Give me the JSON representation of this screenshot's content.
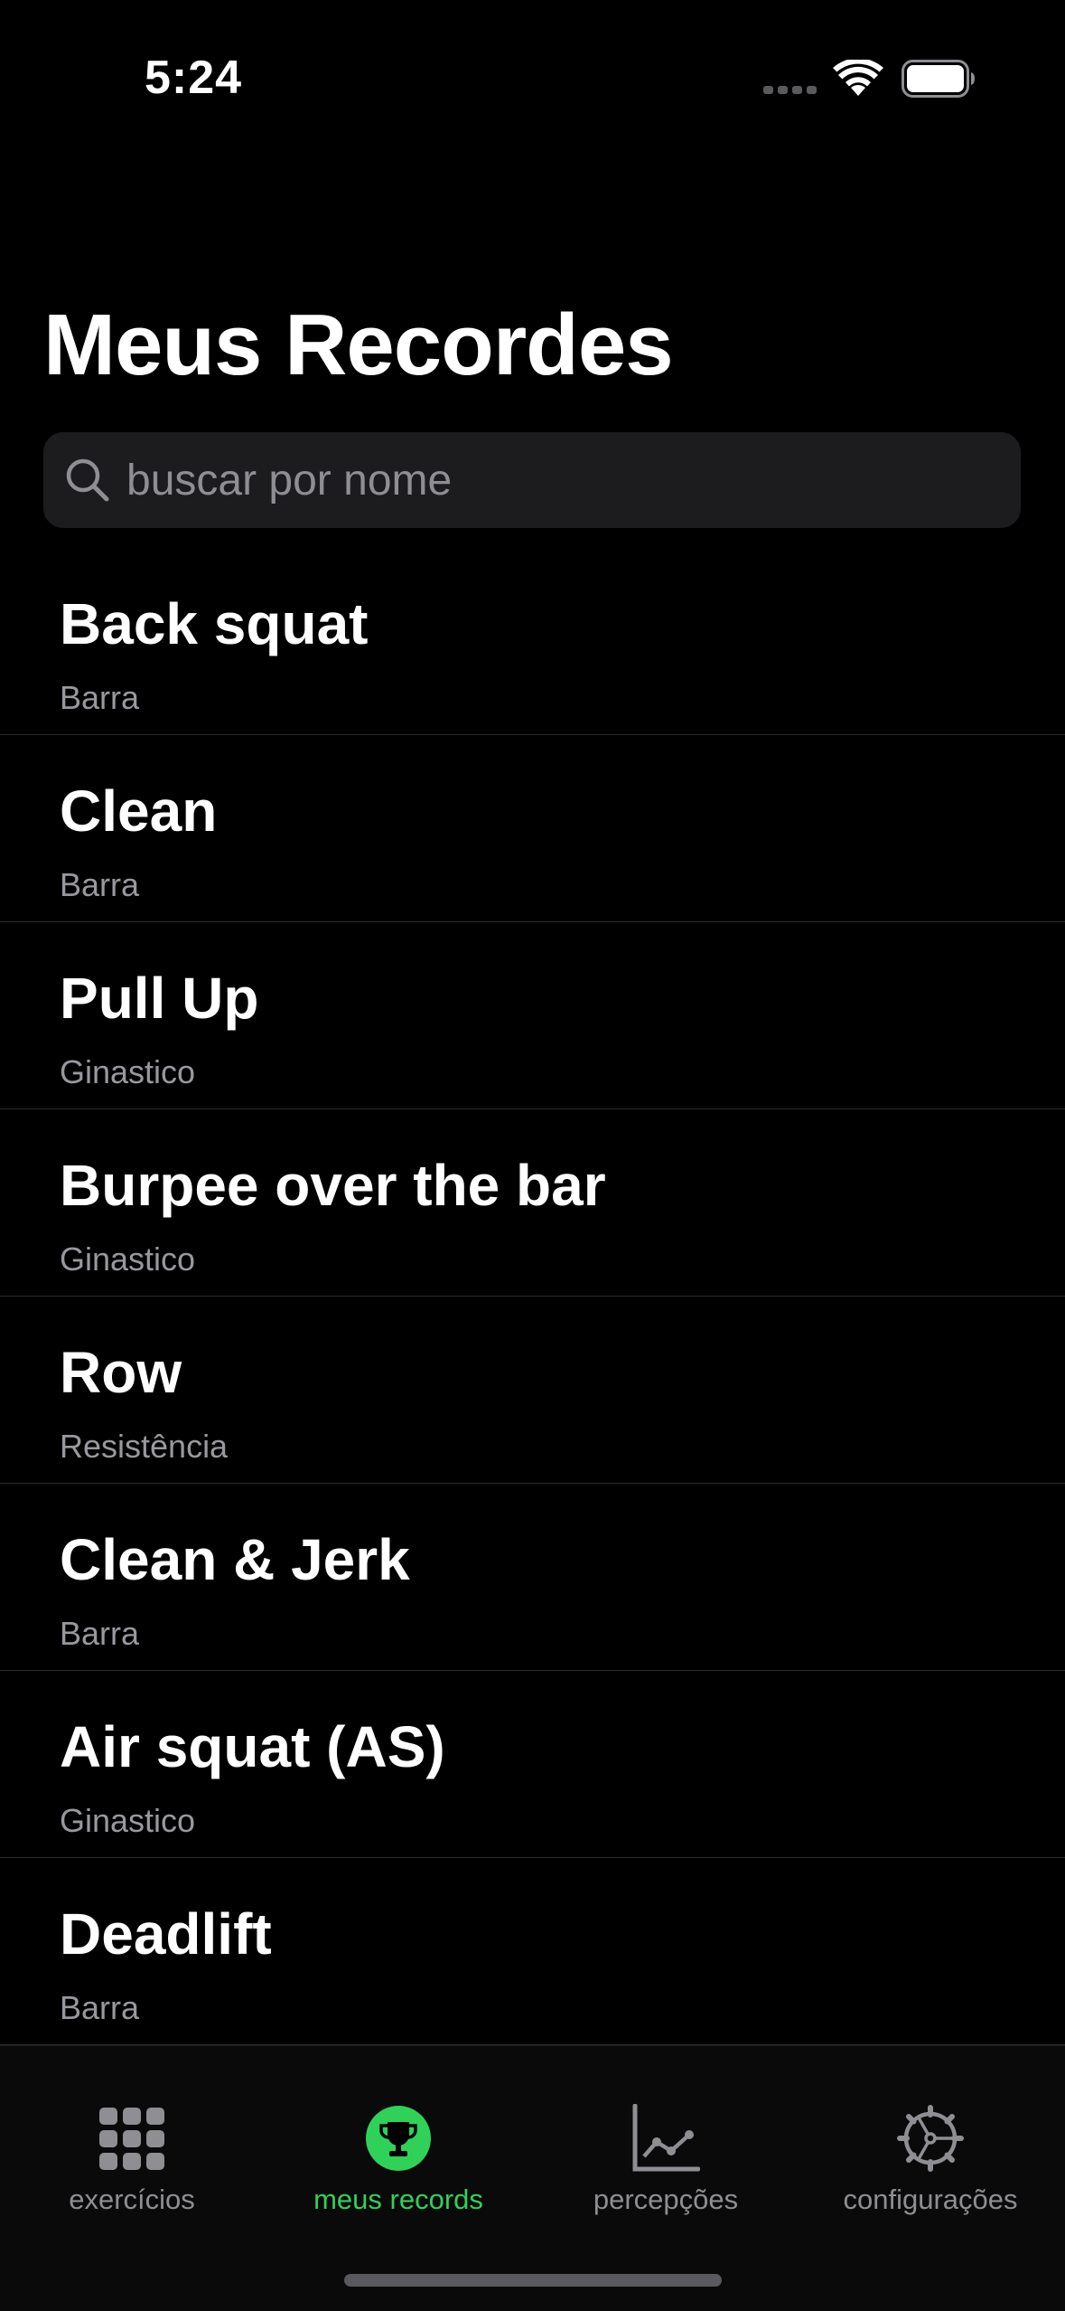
{
  "status_bar": {
    "time": "5:24"
  },
  "page": {
    "title": "Meus Recordes"
  },
  "search": {
    "placeholder": "buscar por nome",
    "value": ""
  },
  "records": [
    {
      "name": "Back squat",
      "category": "Barra"
    },
    {
      "name": "Clean",
      "category": "Barra"
    },
    {
      "name": "Pull Up",
      "category": "Ginastico"
    },
    {
      "name": "Burpee over the bar",
      "category": "Ginastico"
    },
    {
      "name": "Row",
      "category": "Resistência"
    },
    {
      "name": "Clean & Jerk",
      "category": "Barra"
    },
    {
      "name": "Air squat (AS)",
      "category": "Ginastico"
    },
    {
      "name": "Deadlift",
      "category": "Barra"
    }
  ],
  "tab_bar": {
    "tabs": [
      {
        "label": "exercícios",
        "icon": "grid-icon",
        "active": false
      },
      {
        "label": "meus records",
        "icon": "trophy-icon",
        "active": true
      },
      {
        "label": "percepções",
        "icon": "chart-line-icon",
        "active": false
      },
      {
        "label": "configurações",
        "icon": "gear-icon",
        "active": false
      }
    ]
  },
  "colors": {
    "background": "#000000",
    "accent": "#30d158",
    "secondary_text": "#98989e",
    "search_background": "#1c1c1e"
  }
}
